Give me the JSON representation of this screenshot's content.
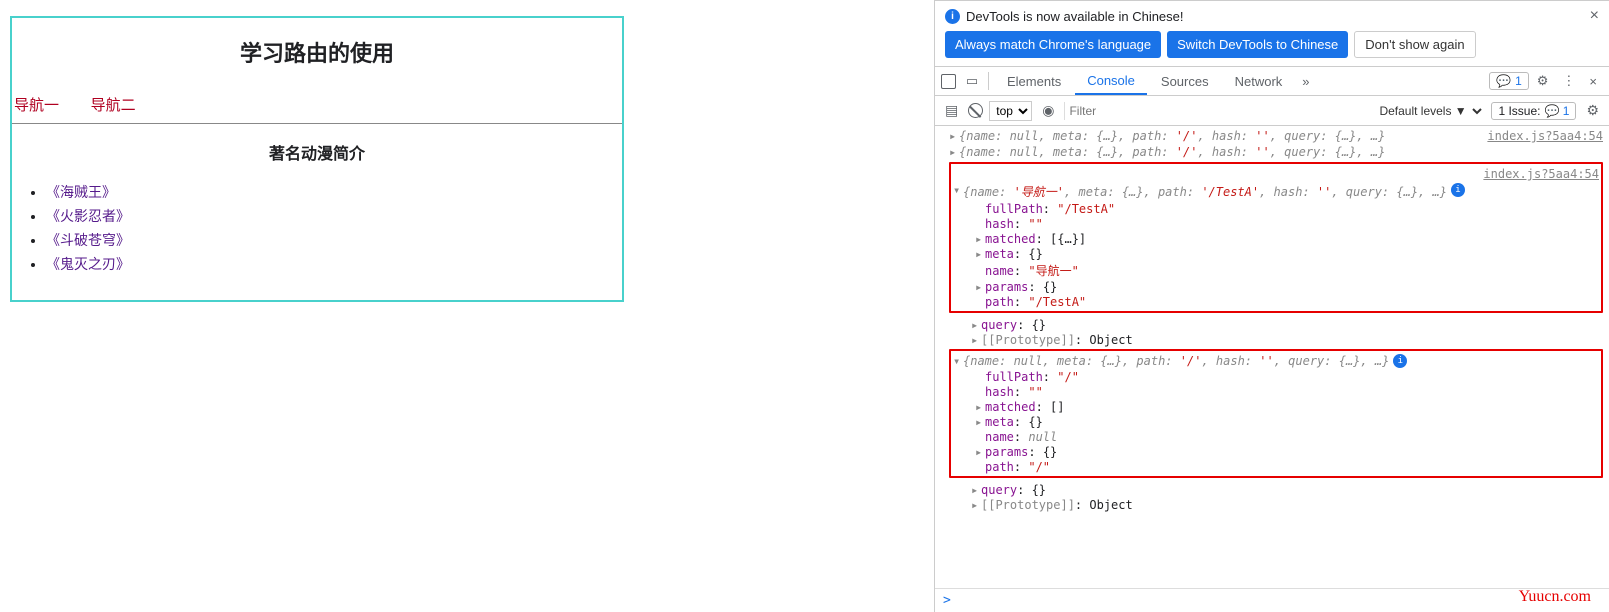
{
  "page": {
    "title": "学习路由的使用",
    "nav": [
      "导航一",
      "导航二"
    ],
    "sub_title": "著名动漫简介",
    "list": [
      "《海贼王》",
      "《火影忍者》",
      "《斗破苍穹》",
      "《鬼灭之刃》"
    ]
  },
  "devtools": {
    "info_msg": "DevTools is now available in Chinese!",
    "btn_match": "Always match Chrome's language",
    "btn_switch": "Switch DevTools to Chinese",
    "btn_dont": "Don't show again",
    "tabs": {
      "elements": "Elements",
      "console": "Console",
      "sources": "Sources",
      "network": "Network"
    },
    "msg_badge": "1",
    "filter": {
      "top": "top",
      "placeholder": "Filter",
      "levels": "Default levels",
      "issue_label": "1 Issue:",
      "issue_count": "1"
    },
    "src_link": "index.js?5aa4:54",
    "prompt": ">",
    "watermark": "Yuucn.com",
    "console": {
      "collapsed_line": "{name: null, meta: {…}, path: '/', hash: '', query: {…}, …}",
      "expanded1": {
        "header": "{name: '导航一', meta: {…}, path: '/TestA', hash: '', query: {…}, …}",
        "fullPath": "\"/TestA\"",
        "hash": "\"\"",
        "matched": "[{…}]",
        "meta": "{}",
        "name": "\"导航一\"",
        "params": "{}",
        "path": "\"/TestA\""
      },
      "after1": {
        "query": "{}",
        "proto": "Object"
      },
      "expanded2": {
        "header": "{name: null, meta: {…}, path: '/', hash: '', query: {…}, …}",
        "fullPath": "\"/\"",
        "hash": "\"\"",
        "matched": "[]",
        "meta": "{}",
        "name": "null",
        "params": "{}",
        "path": "\"/\""
      },
      "after2": {
        "query": "{}",
        "proto": "Object"
      }
    }
  }
}
